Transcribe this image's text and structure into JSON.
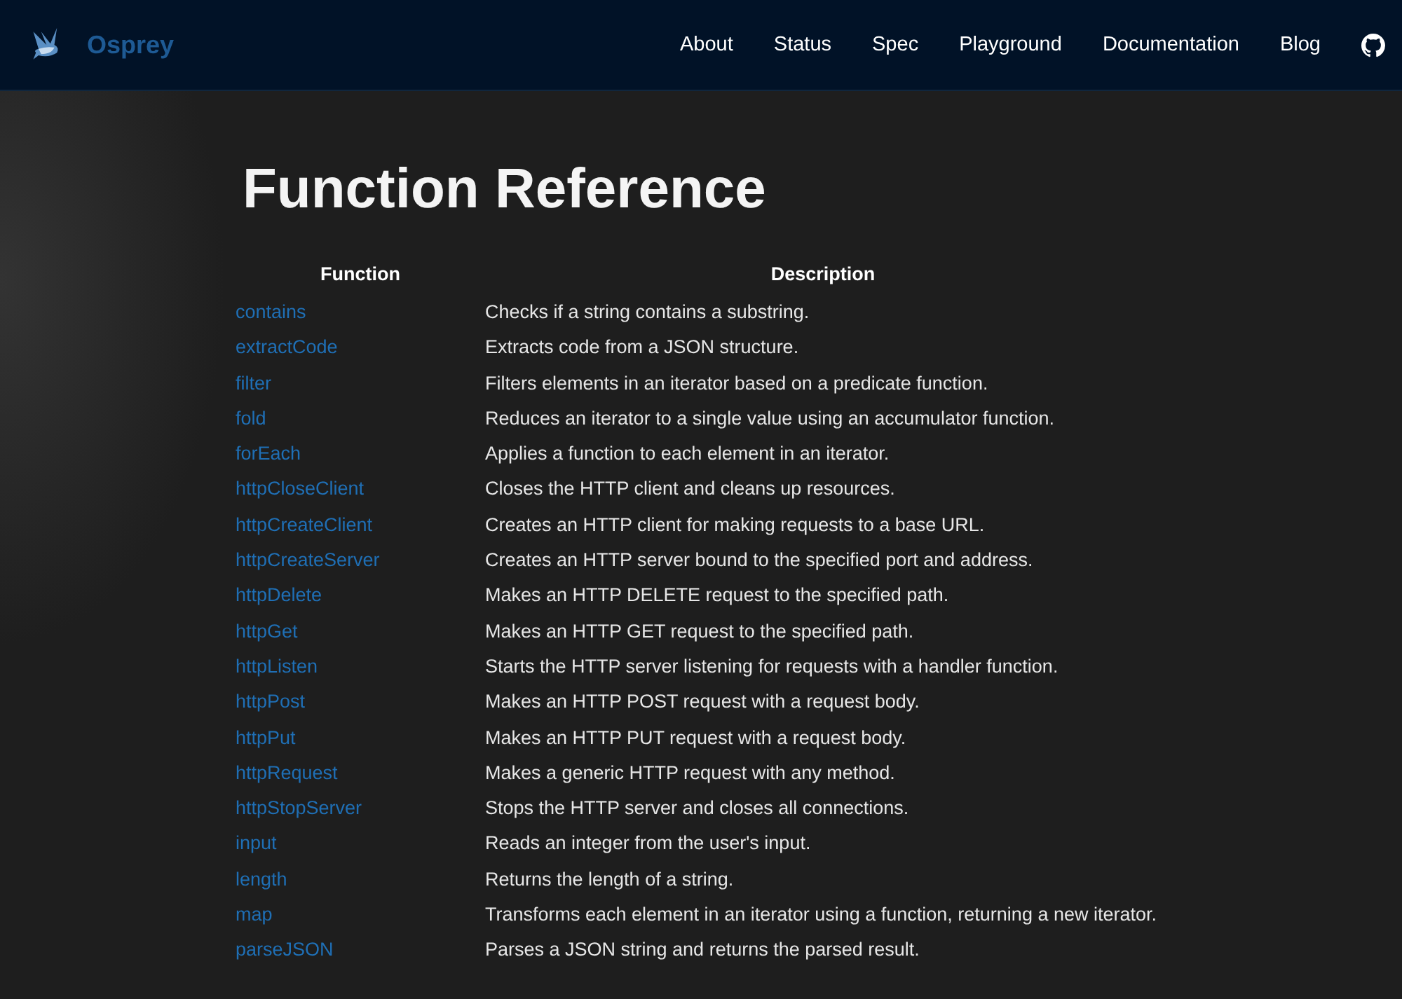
{
  "header": {
    "brand": "Osprey",
    "nav": [
      {
        "label": "About"
      },
      {
        "label": "Status"
      },
      {
        "label": "Spec"
      },
      {
        "label": "Playground"
      },
      {
        "label": "Documentation"
      },
      {
        "label": "Blog"
      }
    ]
  },
  "heading": "Function Reference",
  "table": {
    "columns": [
      "Function",
      "Description"
    ],
    "rows": [
      [
        "contains",
        "Checks if a string contains a substring."
      ],
      [
        "extractCode",
        "Extracts code from a JSON structure."
      ],
      [
        "filter",
        "Filters elements in an iterator based on a predicate function."
      ],
      [
        "fold",
        "Reduces an iterator to a single value using an accumulator function."
      ],
      [
        "forEach",
        "Applies a function to each element in an iterator."
      ],
      [
        "httpCloseClient",
        "Closes the HTTP client and cleans up resources."
      ],
      [
        "httpCreateClient",
        "Creates an HTTP client for making requests to a base URL."
      ],
      [
        "httpCreateServer",
        "Creates an HTTP server bound to the specified port and address."
      ],
      [
        "httpDelete",
        "Makes an HTTP DELETE request to the specified path."
      ],
      [
        "httpGet",
        "Makes an HTTP GET request to the specified path."
      ],
      [
        "httpListen",
        "Starts the HTTP server listening for requests with a handler function."
      ],
      [
        "httpPost",
        "Makes an HTTP POST request with a request body."
      ],
      [
        "httpPut",
        "Makes an HTTP PUT request with a request body."
      ],
      [
        "httpRequest",
        "Makes a generic HTTP request with any method."
      ],
      [
        "httpStopServer",
        "Stops the HTTP server and closes all connections."
      ],
      [
        "input",
        "Reads an integer from the user's input."
      ],
      [
        "length",
        "Returns the length of a string."
      ],
      [
        "map",
        "Transforms each element in an iterator using a function, returning a new iterator."
      ],
      [
        "parseJSON",
        "Parses a JSON string and returns the parsed result."
      ]
    ]
  }
}
